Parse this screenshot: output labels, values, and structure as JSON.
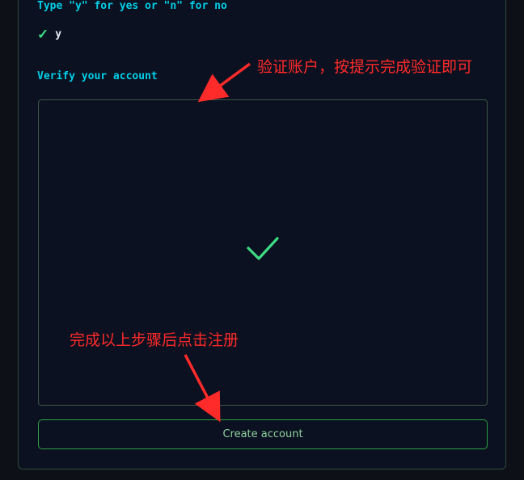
{
  "prompt": {
    "question": "Type \"y\" for yes or \"n\" for no",
    "answer": "y",
    "answer_icon": "check-icon"
  },
  "verify": {
    "label": "Verify your account",
    "status_icon": "check-icon"
  },
  "actions": {
    "create_account_label": "Create account"
  },
  "annotations": {
    "verify_note": "验证账户，按提示完成验证即可",
    "register_note": "完成以上步骤后点击注册"
  },
  "colors": {
    "accent": "#00cfe8",
    "success": "#3ddc84",
    "annotation": "#ff2a2a",
    "button_border": "#2ea043"
  }
}
